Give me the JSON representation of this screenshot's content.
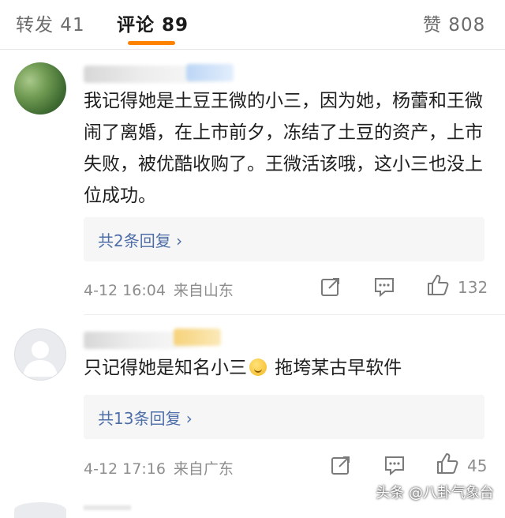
{
  "tabs": {
    "repost": "转发 41",
    "comment": "评论 89",
    "like": "赞 808"
  },
  "comments": [
    {
      "text": "我记得她是土豆王微的小三，因为她，杨蕾和王微闹了离婚，在上市前夕，冻结了土豆的资产，上市失败，被优酷收购了。王微活该哦，这小三也没上位成功。",
      "replies_label": "共2条回复 ›",
      "time": "4-12 16:04",
      "source": "来自山东",
      "likes": "132"
    },
    {
      "text_before": "只记得她是知名小三",
      "text_after": " 拖垮某古早软件",
      "replies_label": "共13条回复 ›",
      "time": "4-12 17:16",
      "source": "来自广东",
      "likes": "45"
    }
  ],
  "watermark": "头条 @八卦气象台",
  "icons": [
    "share-icon",
    "comment-icon",
    "like-icon",
    "smile-emoji-icon",
    "avatar-icon"
  ],
  "colors": {
    "accent": "#ff8200",
    "link": "#4e6ea8",
    "muted": "#8e8e8e"
  }
}
